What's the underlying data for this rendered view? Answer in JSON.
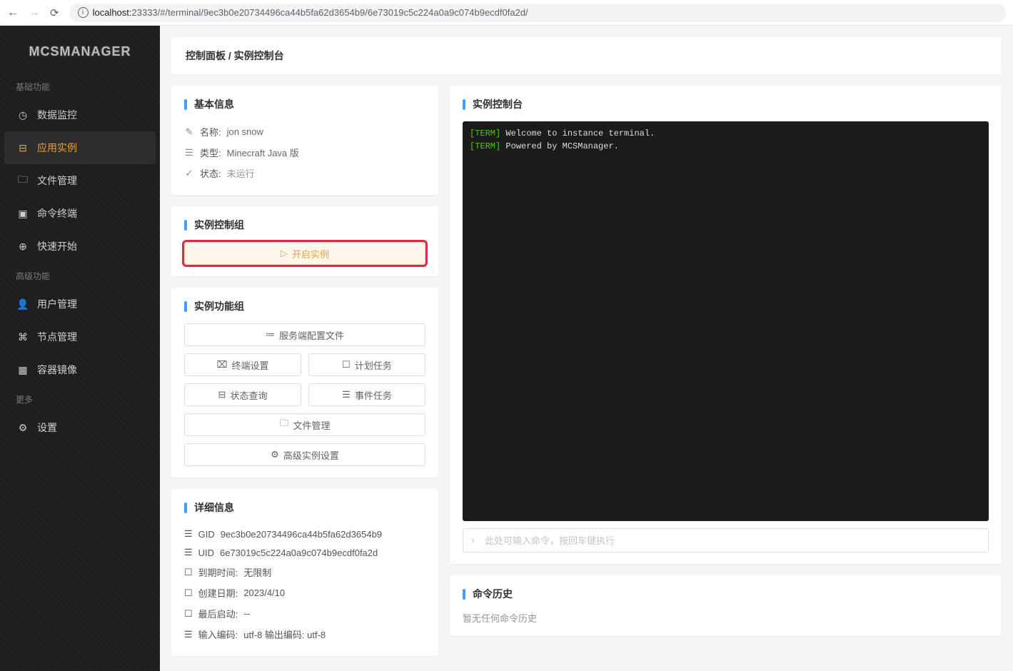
{
  "browser": {
    "url_host": "localhost:",
    "url_port_path": "23333/#/terminal/9ec3b0e20734496ca44b5fa62d3654b9/6e73019c5c224a0a9c074b9ecdf0fa2d/"
  },
  "logo": "MCSMANAGER",
  "sidebar": {
    "sections": [
      {
        "title": "基础功能"
      },
      {
        "title": "高级功能"
      },
      {
        "title": "更多"
      }
    ],
    "items": [
      {
        "label": "数据监控"
      },
      {
        "label": "应用实例"
      },
      {
        "label": "文件管理"
      },
      {
        "label": "命令终端"
      },
      {
        "label": "快速开始"
      },
      {
        "label": "用户管理"
      },
      {
        "label": "节点管理"
      },
      {
        "label": "容器镜像"
      },
      {
        "label": "设置"
      }
    ]
  },
  "breadcrumb": "控制面板 / 实例控制台",
  "basic_info": {
    "title": "基本信息",
    "name_label": "名称:",
    "name_value": "jon snow",
    "type_label": "类型:",
    "type_value": "Minecraft Java 版",
    "status_label": "状态:",
    "status_value": "未运行"
  },
  "control_group": {
    "title": "实例控制组",
    "start_label": "开启实例"
  },
  "func_group": {
    "title": "实例功能组",
    "config_file": "服务端配置文件",
    "terminal_settings": "终端设置",
    "scheduled_tasks": "计划任务",
    "status_query": "状态查询",
    "event_tasks": "事件任务",
    "file_manage": "文件管理",
    "advanced": "高级实例设置"
  },
  "detail": {
    "title": "详细信息",
    "gid_label": "GID",
    "gid_value": "9ec3b0e20734496ca44b5fa62d3654b9",
    "uid_label": "UID",
    "uid_value": "6e73019c5c224a0a9c074b9ecdf0fa2d",
    "expire_label": "到期时间:",
    "expire_value": "无限制",
    "create_label": "创建日期:",
    "create_value": "2023/4/10",
    "last_start_label": "最后启动:",
    "last_start_value": "--",
    "encoding_label": "输入编码:",
    "encoding_value": "utf-8 输出编码: utf-8"
  },
  "terminal": {
    "title": "实例控制台",
    "lines": [
      {
        "tag": "[TERM]",
        "text": "Welcome to instance terminal."
      },
      {
        "tag": "[TERM]",
        "text": "Powered by MCSManager."
      }
    ],
    "input_placeholder": "此处可输入命令，按回车键执行"
  },
  "history": {
    "title": "命令历史",
    "empty": "暂无任何命令历史"
  }
}
